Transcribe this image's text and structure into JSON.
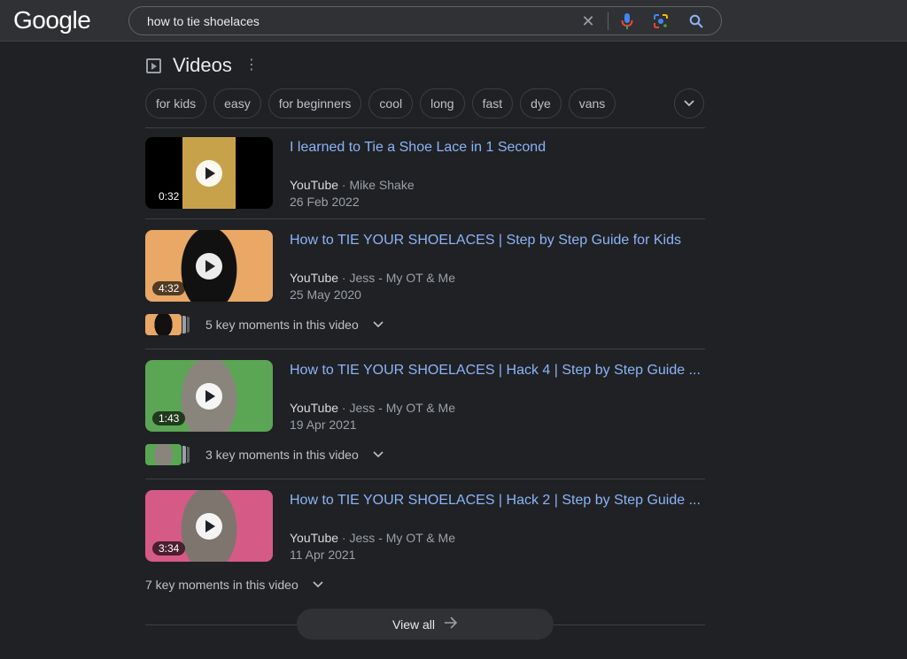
{
  "header": {
    "logo_text": "Google",
    "search_value": "how to tie shoelaces",
    "clear_glyph": "✕"
  },
  "section": {
    "title": "Videos",
    "menu_glyph": "⋮"
  },
  "chips": [
    "for kids",
    "easy",
    "for beginners",
    "cool",
    "long",
    "fast",
    "dye",
    "vans"
  ],
  "results": [
    {
      "title": "I learned to Tie a Shoe Lace in 1 Second",
      "source": "YouTube",
      "separator": " · ",
      "author": "Mike Shake",
      "date": "26 Feb 2022",
      "duration": "0:32",
      "key_moments": null,
      "thumb_colors": [
        "#000000",
        "#c8a24a",
        "#d8c4b0"
      ]
    },
    {
      "title": "How to TIE YOUR SHOELACES | Step by Step Guide for Kids",
      "source": "YouTube",
      "separator": " · ",
      "author": "Jess - My OT & Me",
      "date": "25 May 2020",
      "duration": "4:32",
      "key_moments": "5 key moments in this video",
      "thumb_colors": [
        "#e9a866",
        "#111111",
        "#e07aa0"
      ]
    },
    {
      "title": "How to TIE YOUR SHOELACES | Hack 4 | Step by Step Guide ...",
      "source": "YouTube",
      "separator": " · ",
      "author": "Jess - My OT & Me",
      "date": "19 Apr 2021",
      "duration": "1:43",
      "key_moments": "3 key moments in this video",
      "thumb_colors": [
        "#5aa655",
        "#8a857c",
        "#e2c6b4"
      ]
    },
    {
      "title": "How to TIE YOUR SHOELACES | Hack 2 | Step by Step Guide ...",
      "source": "YouTube",
      "separator": " · ",
      "author": "Jess - My OT & Me",
      "date": "11 Apr 2021",
      "duration": "3:34",
      "key_moments": "7 key moments in this video",
      "thumb_colors": [
        "#d65a86",
        "#7d756e",
        "#e6c2b0"
      ]
    }
  ],
  "view_all": {
    "label": "View all",
    "arrow_glyph": "→"
  },
  "colors": {
    "background": "#202124",
    "link": "#8ab4f8",
    "topbar": "#303134"
  }
}
